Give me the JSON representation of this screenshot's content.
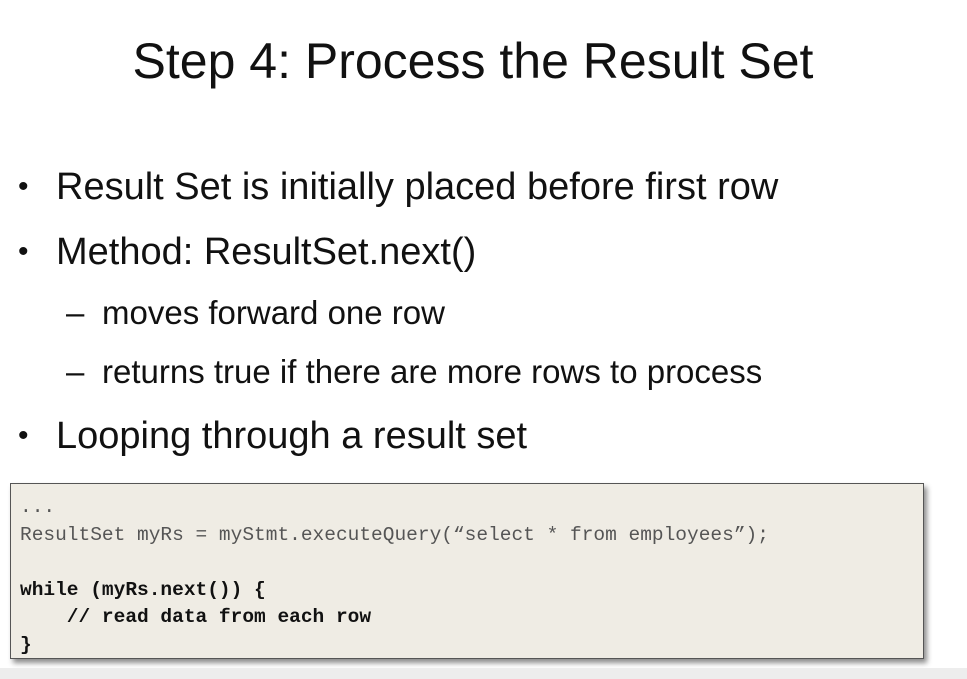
{
  "slide": {
    "title": "Step 4: Process the Result Set",
    "bullets": [
      {
        "marker": "•",
        "text": "Result Set is initially placed before first row"
      },
      {
        "marker": "•",
        "text": "Method: ResultSet.next()"
      },
      {
        "marker": "•",
        "text": "Looping through a result set"
      }
    ],
    "sub_bullets": [
      {
        "marker": "–",
        "text": "moves forward one row"
      },
      {
        "marker": "–",
        "text": "returns true if there are more rows to process"
      }
    ],
    "code": {
      "lines": [
        "...",
        "ResultSet myRs = myStmt.executeQuery(“select * from employees”);",
        "",
        "while (myRs.next()) {",
        "    // read data from each row",
        "}"
      ]
    }
  }
}
